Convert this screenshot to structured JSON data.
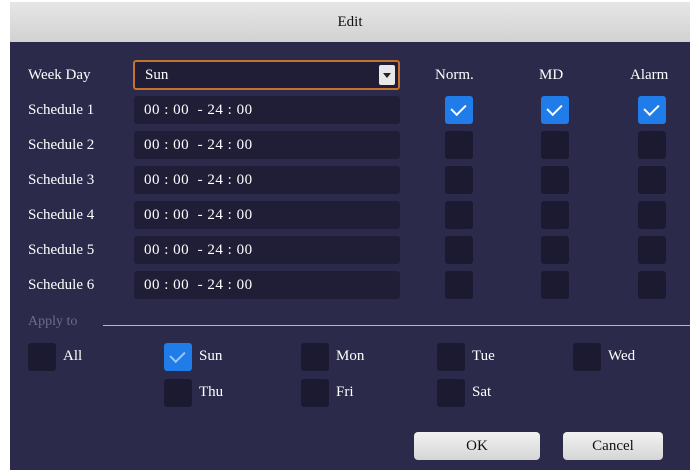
{
  "dialog": {
    "title": "Edit"
  },
  "header": {
    "weekday_label": "Week Day",
    "weekday_value": "Sun",
    "col_norm": "Norm.",
    "col_md": "MD",
    "col_alarm": "Alarm"
  },
  "schedules": [
    {
      "label": "Schedule 1",
      "time": "00 : 00  - 24 : 00",
      "norm": true,
      "md": true,
      "alarm": true
    },
    {
      "label": "Schedule 2",
      "time": "00 : 00  - 24 : 00",
      "norm": false,
      "md": false,
      "alarm": false
    },
    {
      "label": "Schedule 3",
      "time": "00 : 00  - 24 : 00",
      "norm": false,
      "md": false,
      "alarm": false
    },
    {
      "label": "Schedule 4",
      "time": "00 : 00  - 24 : 00",
      "norm": false,
      "md": false,
      "alarm": false
    },
    {
      "label": "Schedule 5",
      "time": "00 : 00  - 24 : 00",
      "norm": false,
      "md": false,
      "alarm": false
    },
    {
      "label": "Schedule 6",
      "time": "00 : 00  - 24 : 00",
      "norm": false,
      "md": false,
      "alarm": false
    }
  ],
  "apply": {
    "label": "Apply to",
    "days": [
      {
        "label": "All",
        "checked": false
      },
      {
        "label": "Sun",
        "checked": true
      },
      {
        "label": "Mon",
        "checked": false
      },
      {
        "label": "Tue",
        "checked": false
      },
      {
        "label": "Wed",
        "checked": false
      },
      {
        "label": "Thu",
        "checked": false
      },
      {
        "label": "Fri",
        "checked": false
      },
      {
        "label": "Sat",
        "checked": false
      }
    ]
  },
  "buttons": {
    "ok": "OK",
    "cancel": "Cancel"
  },
  "colors": {
    "dialog_bg": "#2b2a4a",
    "field_bg": "#1f1e36",
    "checkbox_checked": "#1f7ce8",
    "focus_border": "#c4722c"
  }
}
